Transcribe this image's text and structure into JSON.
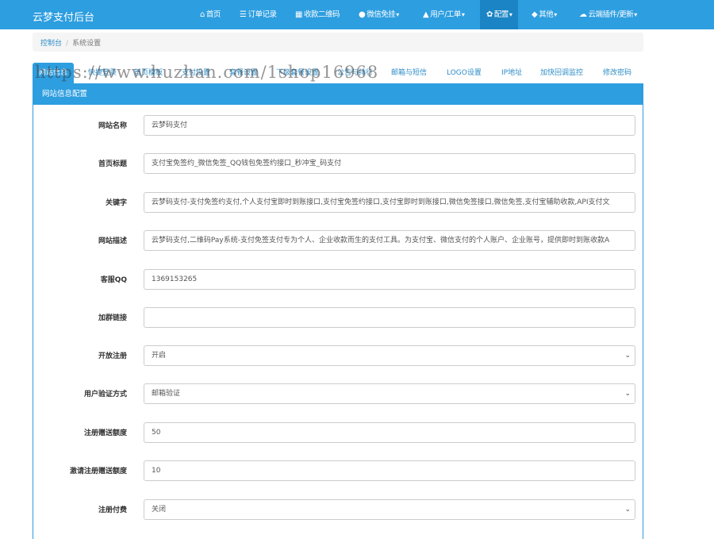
{
  "navbar": {
    "brand": "云梦支付后台",
    "items": [
      {
        "icon": "home-icon",
        "glyph": "⌂",
        "label": "首页"
      },
      {
        "icon": "list-icon",
        "glyph": "☰",
        "label": "订单记录"
      },
      {
        "icon": "qrcode-icon",
        "glyph": "▦",
        "label": "收款二维码"
      },
      {
        "icon": "wechat-icon",
        "glyph": "●",
        "label": "微信免挂"
      },
      {
        "icon": "user-icon",
        "glyph": "▲",
        "label": "用户/工单"
      },
      {
        "icon": "gear-icon",
        "glyph": "✿",
        "label": "配置"
      },
      {
        "icon": "cube-icon",
        "glyph": "◆",
        "label": "其他"
      },
      {
        "icon": "cloud-icon",
        "glyph": "☁",
        "label": "云端插件/更新"
      }
    ]
  },
  "breadcrumb": {
    "home": "控制台",
    "sep": "/",
    "current": "系统设置"
  },
  "tabs": [
    "网站信息",
    "快捷登录",
    "首页模板",
    "支付设置",
    "套餐设置",
    "下级套餐设置",
    "公告与排行",
    "邮箱与短信",
    "LOGO设置",
    "IP地址",
    "加快回调监控",
    "修改密码"
  ],
  "watermark": "https://www.huzhan.com/1shop16968",
  "panel": {
    "title": "网站信息配置"
  },
  "form": [
    {
      "label": "网站名称",
      "value": "云梦码支付",
      "type": "text"
    },
    {
      "label": "首页标题",
      "value": "支付宝免签约_微信免签_QQ钱包免签约接口_秒冲宝_码支付",
      "type": "text"
    },
    {
      "label": "关键字",
      "value": "云梦码支付-支付免签约支付,个人支付宝即时到账接口,支付宝免签约接口,支付宝即时到账接口,微信免签接口,微信免签,支付宝辅助收款,API支付文",
      "type": "text"
    },
    {
      "label": "网站描述",
      "value": "云梦码支付,二维码Pay系统-支付免签支付专为个人、企业收款而生的支付工具。为支付宝、微信支付的个人账户、企业账号，提供即时到账收款A",
      "type": "text"
    },
    {
      "label": "客服QQ",
      "value": "1369153265",
      "type": "text"
    },
    {
      "label": "加群链接",
      "value": "",
      "type": "text"
    },
    {
      "label": "开放注册",
      "value": "开启",
      "type": "select"
    },
    {
      "label": "用户验证方式",
      "value": "邮箱验证",
      "type": "select"
    },
    {
      "label": "注册赠送额度",
      "value": "50",
      "type": "text"
    },
    {
      "label": "激请注册赠送额度",
      "value": "10",
      "type": "text"
    },
    {
      "label": "注册付费",
      "value": "关闭",
      "type": "select"
    }
  ]
}
